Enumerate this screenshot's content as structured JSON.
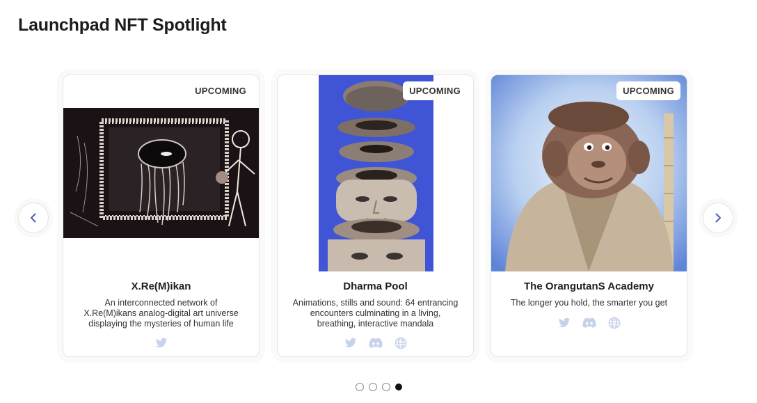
{
  "header": {
    "title": "Launchpad NFT Spotlight"
  },
  "carousel": {
    "prev_icon": "chevron-left-icon",
    "next_icon": "chevron-right-icon",
    "accent_color": "#4a5bbf",
    "dots": [
      {
        "active": false
      },
      {
        "active": false
      },
      {
        "active": false
      },
      {
        "active": true
      }
    ]
  },
  "cards": [
    {
      "badge": "UPCOMING",
      "name": "X.Re(M)ikan",
      "description": "An interconnected network of X.Re(M)ikans analog-digital art universe displaying the mysteries of human life",
      "socials": [
        "twitter-icon"
      ]
    },
    {
      "badge": "UPCOMING",
      "name": "Dharma Pool",
      "description": "Animations, stills and sound: 64 entrancing encounters culminating in a living, breathing, interactive mandala",
      "socials": [
        "twitter-icon",
        "discord-icon",
        "globe-icon"
      ]
    },
    {
      "badge": "UPCOMING",
      "name": "The OrangutanS Academy",
      "description": "The longer you hold, the smarter you get",
      "socials": [
        "twitter-icon",
        "discord-icon",
        "globe-icon"
      ]
    }
  ],
  "colors": {
    "social_icon": "#c7d3ea",
    "badge_text": "#333333",
    "dharma_bg": "#3f55d6",
    "orangutan_sky": "#8fb3ea"
  }
}
